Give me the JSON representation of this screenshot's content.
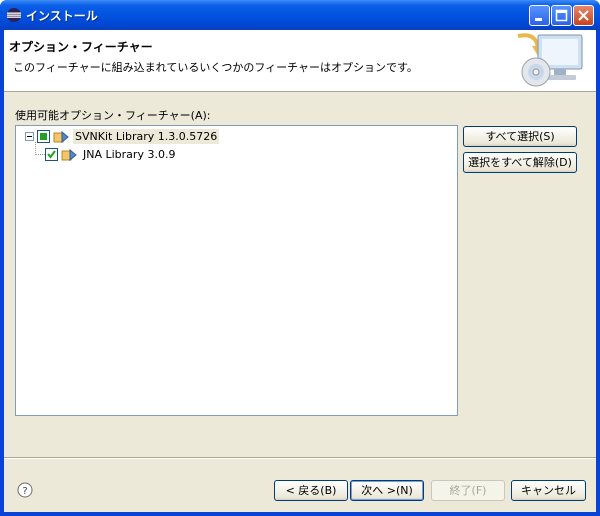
{
  "window": {
    "title": "インストール",
    "title_icon": "eclipse-icon"
  },
  "header": {
    "title": "オプション・フィーチャー",
    "description": "このフィーチャーに組み込まれているいくつかのフィーチャーはオプションです。",
    "graphic": "install-monitor-cd-icon"
  },
  "features": {
    "label": "使用可能オプション・フィーチャー(A):",
    "items": [
      {
        "label": "SVNKit Library 1.3.0.5726",
        "state": "partial",
        "expanded": true
      },
      {
        "label": "JNA Library 3.0.9",
        "state": "checked"
      }
    ]
  },
  "buttons": {
    "select_all": "すべて選択(S)",
    "deselect_all": "選択をすべて解除(D)",
    "back": "< 戻る(B)",
    "next": "次へ >(N)",
    "finish": "終了(F)",
    "cancel": "キャンセル"
  },
  "colors": {
    "titlebar": "#0254e0",
    "dialog_bg": "#ece9d8",
    "partial_check": "#21a121"
  }
}
